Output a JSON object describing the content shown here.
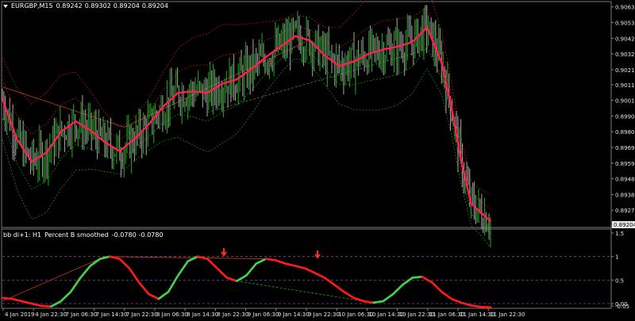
{
  "header": {
    "symbol": "EURGBP,M15",
    "ohlc": [
      "0.89242",
      "0.89302",
      "0.89204",
      "0.89204"
    ]
  },
  "indicator": {
    "name": "bb di+1: H1",
    "label": "Percent B smoothed",
    "values": [
      "-0.0780",
      "-0.0780"
    ]
  },
  "colors": {
    "background": "#000000",
    "price_up": "#1f9e1f",
    "price_down": "#9a9a9a",
    "ma": "#ff1f4f",
    "band_upper": "#b01515",
    "band_lower": "#1c8a1c",
    "osc_up": "#44d14c",
    "osc_down": "#ff1a1a",
    "level_line": "#8844aa",
    "current_price_tag": "#e8e8e8"
  },
  "icons": [
    "triangle-down-icon",
    "arrow-down-icon"
  ],
  "chart_data": [
    {
      "type": "line",
      "title": "EURGBP,M15",
      "ylim": [
        0.8917,
        0.9066
      ],
      "price_axis_ticks": [
        "0.90635",
        "0.90530",
        "0.90425",
        "0.90320",
        "0.90215",
        "0.90115",
        "0.90010",
        "0.89905",
        "0.89800",
        "0.89695",
        "0.89590",
        "0.89485",
        "0.89380",
        "0.89275",
        "0.89170"
      ],
      "current_price": "0.89204",
      "time_axis_labels": [
        "4 Jan 2019",
        "4 Jan 22:30",
        "7 Jan 06:30",
        "7 Jan 14:30",
        "7 Jan 22:30",
        "8 Jan 06:30",
        "8 Jan 14:30",
        "8 Jan 22:30",
        "9 Jan 06:30",
        "9 Jan 14:30",
        "9 Jan 22:30",
        "10 Jan 06:30",
        "10 Jan 14:30",
        "10 Jan 22:30",
        "11 Jan 06:30",
        "11 Jan 14:30",
        "11 Jan 22:30"
      ],
      "series": [
        {
          "x": [
            0,
            0.03,
            0.06,
            0.09,
            0.12,
            0.15,
            0.18,
            0.21,
            0.24,
            0.27,
            0.3,
            0.33,
            0.36,
            0.39,
            0.42,
            0.45,
            0.48,
            0.51,
            0.54,
            0.57,
            0.6,
            0.63,
            0.66,
            0.69,
            0.72,
            0.75,
            0.78,
            0.81,
            0.84,
            0.87,
            0.9,
            0.92,
            0.94,
            0.96,
            1.0
          ],
          "values": [
            0.9002,
            0.8975,
            0.896,
            0.8966,
            0.898,
            0.8987,
            0.8981,
            0.8973,
            0.8967,
            0.8975,
            0.8985,
            0.8997,
            0.9006,
            0.9007,
            0.9006,
            0.9012,
            0.9015,
            0.9022,
            0.903,
            0.9037,
            0.9044,
            0.9041,
            0.9031,
            0.9024,
            0.9027,
            0.9032,
            0.9035,
            0.9037,
            0.904,
            0.905,
            0.9026,
            0.8996,
            0.896,
            0.8932,
            0.892
          ]
        }
      ]
    },
    {
      "type": "line",
      "title": "Percent B smoothed",
      "ylim": [
        -0.05,
        1.5
      ],
      "levels": [
        0,
        0.5,
        1
      ],
      "axis_ticks": [
        "1.5",
        "1",
        "0.5",
        "0.00",
        "-0.05"
      ],
      "series": [
        {
          "x": [
            0,
            0.02,
            0.04,
            0.06,
            0.08,
            0.1,
            0.12,
            0.14,
            0.16,
            0.18,
            0.2,
            0.22,
            0.24,
            0.26,
            0.28,
            0.3,
            0.32,
            0.34,
            0.36,
            0.38,
            0.4,
            0.42,
            0.44,
            0.46,
            0.48,
            0.5,
            0.52,
            0.54,
            0.56,
            0.58,
            0.6,
            0.62,
            0.64,
            0.66,
            0.68,
            0.7,
            0.72,
            0.74,
            0.76,
            0.78,
            0.8,
            0.82,
            0.84,
            0.86,
            0.88,
            0.9,
            0.92,
            0.94,
            0.96,
            0.98,
            1.0
          ],
          "values": [
            0.12,
            0.1,
            0.05,
            0.0,
            -0.05,
            -0.06,
            0.05,
            0.25,
            0.55,
            0.8,
            0.95,
            1.0,
            0.95,
            0.75,
            0.45,
            0.2,
            0.1,
            0.25,
            0.6,
            0.9,
            1.0,
            0.95,
            0.75,
            0.55,
            0.48,
            0.6,
            0.85,
            0.95,
            0.92,
            0.85,
            0.8,
            0.75,
            0.65,
            0.55,
            0.4,
            0.25,
            0.12,
            0.05,
            0.02,
            0.05,
            0.2,
            0.4,
            0.55,
            0.57,
            0.45,
            0.25,
            0.1,
            0.02,
            -0.04,
            -0.07,
            -0.08
          ]
        }
      ]
    }
  ]
}
